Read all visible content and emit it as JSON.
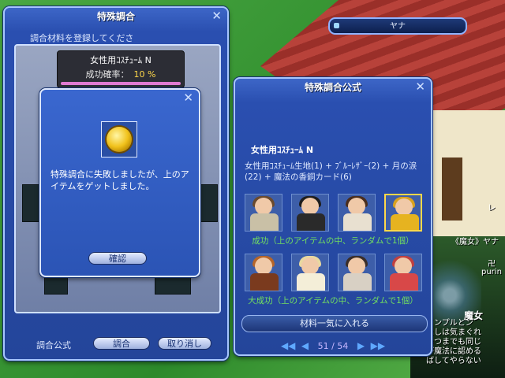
{
  "world": {
    "npc_tag": "《魔女》ヤナ",
    "npc_name": "魔女",
    "player_name": "purin",
    "player_tag": "卍",
    "side_label": "レ",
    "chat_lines": [
      "インプルとン",
      "たしは気まぐれ",
      "いつまでも同じ",
      "が魔法に認める",
      "ばしてやらない"
    ]
  },
  "nameplate": {
    "label": "ヤナ"
  },
  "craft_window": {
    "title": "特殊調合",
    "instruction": "調合材料を登録してくださ",
    "target_item": "女性用ｺｽﾁｭｰﾑ N",
    "rate_label": "成功確率：",
    "rate_value": "10 %",
    "footer_label": "調合公式",
    "combine_button": "調合",
    "cancel_button": "取り消し"
  },
  "fail_dialog": {
    "message": "特殊調合に失敗しましたが、上のアイテムをゲットしました。",
    "confirm_button": "確認"
  },
  "recipe_window": {
    "title": "特殊調合公式",
    "recipe_name": "女性用ｺｽﾁｭｰﾑ N",
    "materials": "女性用ｺｽﾁｭｰﾑ生地(1) + ﾌﾞﾙｰﾚｻﾞｰ(2) + 月の涙(22) + 魔法の香銅カード(6)",
    "success_label": "成功（上のアイテムの中、ランダムで1個）",
    "great_success_label": "大成功（上のアイテムの中、ランダムで1個）",
    "put_all_button": "材料一気に入れる",
    "page_current": "51",
    "page_separator": "/",
    "page_total": "54",
    "first_icon": "◀◀",
    "prev_icon": "◀",
    "next_icon": "▶",
    "last_icon": "▶▶"
  },
  "colors": {
    "success_text": "#73e05f",
    "rate_value": "#ffd84a",
    "window_blue": "#2a4fb0"
  }
}
